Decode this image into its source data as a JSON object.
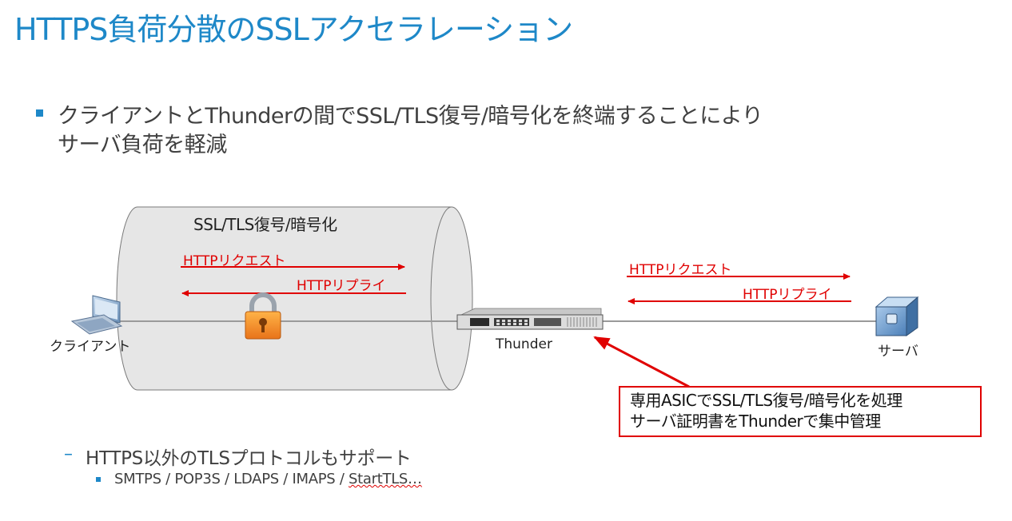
{
  "title": "HTTPS負荷分散のSSLアクセラレーション",
  "bullet": {
    "line1": "クライアントとThunderの間でSSL/TLS復号/暗号化を終端することにより",
    "line2": "サーバ負荷を軽減"
  },
  "diagram": {
    "tunnel_label": "SSL/TLS復号/暗号化",
    "left_request": "HTTPリクエスト",
    "left_reply": "HTTPリプライ",
    "right_request": "HTTPリクエスト",
    "right_reply": "HTTPリプライ",
    "client_label": "クライアント",
    "thunder_label": "Thunder",
    "server_label": "サーバ",
    "callout_line1": "専用ASICでSSL/TLS復号/暗号化を処理",
    "callout_line2": "サーバ証明書をThunderで集中管理"
  },
  "sub_bullet": {
    "text": "HTTPS以外のTLSプロトコルもサポート",
    "detail_prefix": "SMTPS / POP3S / LDAPS / IMAPS / ",
    "detail_suffix": "StartTLS…"
  },
  "colors": {
    "accent": "#1e88c8",
    "arrow_red": "#e00000",
    "tunnel_fill": "#e6e6e6"
  }
}
